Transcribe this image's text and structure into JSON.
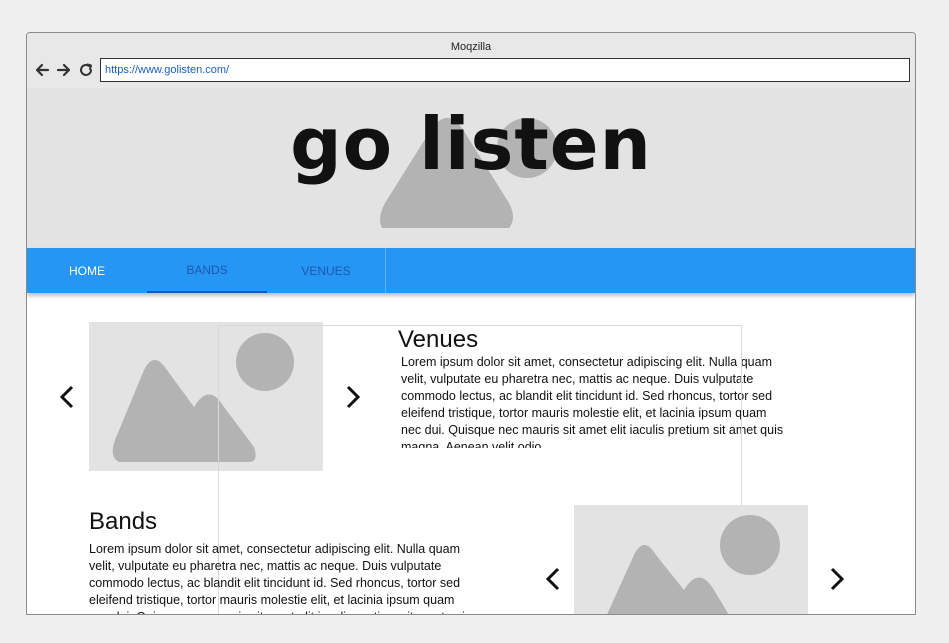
{
  "window": {
    "title": "Moqzilla",
    "url": "https://www.golisten.com/"
  },
  "hero": {
    "title": "go listen"
  },
  "nav": {
    "tabs": [
      {
        "label": "HOME"
      },
      {
        "label": "BANDS"
      },
      {
        "label": "VENUES"
      }
    ],
    "active_tab": "BANDS"
  },
  "venues": {
    "heading": "Venues",
    "body": "Lorem ipsum dolor sit amet, consectetur adipiscing elit. Nulla quam velit, vulputate eu pharetra nec, mattis ac neque. Duis vulputate commodo lectus, ac blandit elit tincidunt id. Sed rhoncus, tortor sed eleifend tristique, tortor mauris molestie elit, et lacinia ipsum quam nec dui. Quisque nec mauris sit amet elit iaculis pretium sit amet quis magna. Aenean velit odio"
  },
  "bands": {
    "heading": "Bands",
    "body": "Lorem ipsum dolor sit amet, consectetur adipiscing elit. Nulla quam velit, vulputate eu pharetra nec, mattis ac neque. Duis vulputate commodo lectus, ac blandit elit tincidunt id. Sed rhoncus, tortor sed eleifend tristique, tortor mauris molestie elit, et lacinia ipsum quam nec dui. Quisque nec mauris sit amet elit iaculis pretium sit amet quis magna. Aenean velit odio"
  },
  "icons": {
    "back": "arrow-left-icon",
    "forward": "arrow-right-icon",
    "reload": "reload-icon",
    "prev": "chevron-left-icon",
    "next": "chevron-right-icon",
    "image": "image-placeholder-icon"
  },
  "colors": {
    "nav_bar": "#2596f3",
    "active_tab": "#1f57b0",
    "hero_bg": "#e3e3e3",
    "placeholder_shape": "#b3b3b3",
    "url_text": "#1a5fc4"
  }
}
